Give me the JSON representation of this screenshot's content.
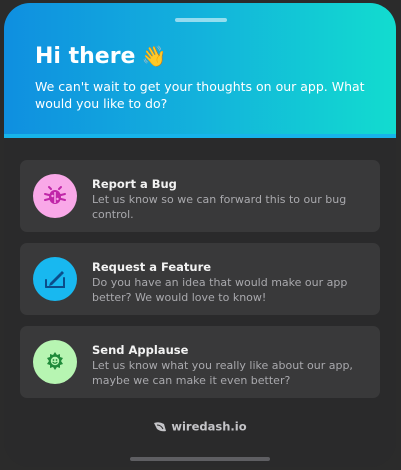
{
  "header": {
    "title": "Hi there",
    "wave_emoji": "👋",
    "subtitle": "We can't wait to get your thoughts on our app. What would you like to do?"
  },
  "options": [
    {
      "title": "Report a Bug",
      "description": "Let us know so we can forward this to our bug control.",
      "icon": "bug-icon",
      "icon_bg": "#f9a8e8",
      "icon_color": "#c026a8"
    },
    {
      "title": "Request a Feature",
      "description": "Do you have an idea that would make our app better? We would love to know!",
      "icon": "feature-icon",
      "icon_bg": "#18b8f0",
      "icon_color": "#0b4d8a"
    },
    {
      "title": "Send Applause",
      "description": "Let us know what you really like about our app, maybe we can make it even better?",
      "icon": "applause-icon",
      "icon_bg": "#b7f5b2",
      "icon_color": "#1f8a3a"
    }
  ],
  "footer": {
    "brand": "wiredash.io",
    "logo_icon": "wiredash-logo-icon"
  },
  "colors": {
    "gradient_start": "#0f8fe0",
    "gradient_end": "#12dccf",
    "card_bg": "#39393a",
    "sheet_bg": "#2a2a2b"
  }
}
